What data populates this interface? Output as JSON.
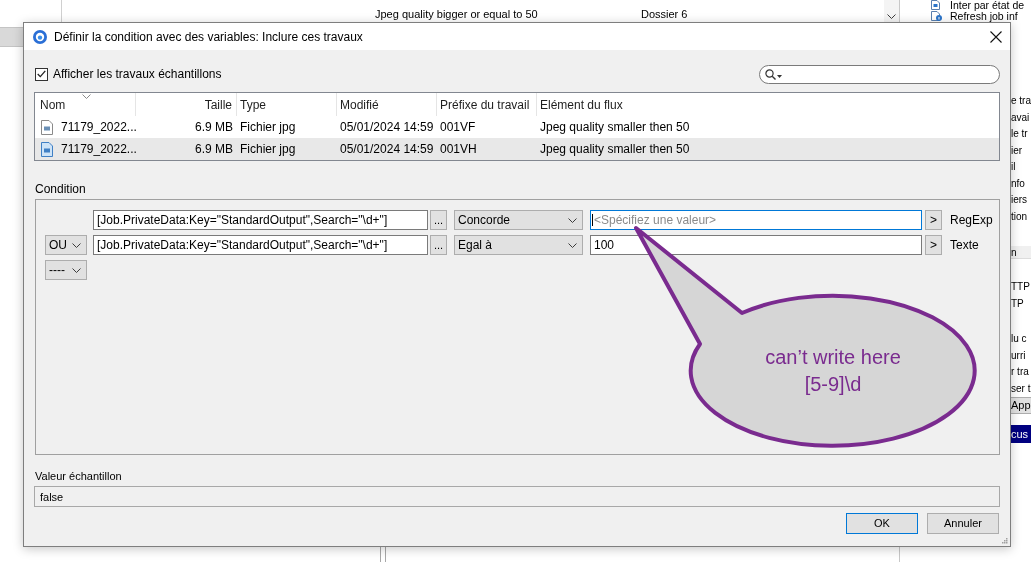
{
  "background": {
    "list_row": {
      "column_1": "Jpeg quality bigger or equal to 50",
      "column_2": "Dossier 6"
    },
    "side_panel": {
      "items": [
        {
          "label": "Inter par état de"
        },
        {
          "label": "Refresh job inf"
        }
      ],
      "groups": [
        {
          "items": [
            {
              "kind": "text",
              "text": "e tra"
            },
            {
              "kind": "text",
              "text": "avai"
            },
            {
              "kind": "text",
              "text": "le tr"
            },
            {
              "kind": "text",
              "text": "ier"
            },
            {
              "kind": "text",
              "text": "il"
            },
            {
              "kind": "text",
              "text": "nfo"
            },
            {
              "kind": "text",
              "text": "iers"
            },
            {
              "kind": "text",
              "text": "tion"
            }
          ]
        },
        {
          "items": [
            {
              "kind": "header",
              "text": "n"
            }
          ]
        },
        {
          "items": [
            {
              "kind": "text",
              "text": "TTP"
            },
            {
              "kind": "text",
              "text": "TP"
            }
          ]
        },
        {
          "items": [
            {
              "kind": "text",
              "text": "lu c"
            },
            {
              "kind": "text",
              "text": "urri"
            },
            {
              "kind": "text",
              "text": "r tra"
            },
            {
              "kind": "text",
              "text": "ser t"
            },
            {
              "kind": "button",
              "text": "App"
            }
          ]
        },
        {
          "items": [
            {
              "kind": "highlight",
              "text": "cus"
            }
          ]
        }
      ]
    }
  },
  "dialog": {
    "title": "Définir la condition avec des variables: Inclure ces travaux",
    "show_samples": {
      "label": "Afficher les travaux échantillons",
      "checked": true
    },
    "file_table": {
      "columns": [
        {
          "label": "Nom",
          "sorted": true
        },
        {
          "label": "Taille",
          "sorted": false
        },
        {
          "label": "Type",
          "sorted": false
        },
        {
          "label": "Modifié",
          "sorted": false
        },
        {
          "label": "Préfixe du travail",
          "sorted": false
        },
        {
          "label": "Elément du flux",
          "sorted": false
        }
      ],
      "rows": [
        {
          "selected": false,
          "cells": [
            "71179_2022...",
            "6.9 MB",
            "Fichier jpg",
            "05/01/2024 14:59",
            "001VF",
            "Jpeg quality smaller then 50"
          ]
        },
        {
          "selected": true,
          "cells": [
            "71179_2022...",
            "6.9 MB",
            "Fichier jpg",
            "05/01/2024 14:59",
            "001VH",
            "Jpeg quality smaller then 50"
          ]
        }
      ]
    },
    "condition": {
      "label": "Condition",
      "rows": [
        {
          "kind": "condition",
          "variable": "[Job.PrivateData:Key=\"StandardOutput\",Search=\"\\d+\"]",
          "browse": "...",
          "operator": "Concorde",
          "value_placeholder": "<Spécifiez une valeur>",
          "focused": true,
          "insert": ">",
          "value_type": "RegExp"
        },
        {
          "kind": "condition",
          "connector": "OU",
          "variable": "[Job.PrivateData:Key=\"StandardOutput\",Search=\"\\d+\"]",
          "browse": "...",
          "operator": "Egal à",
          "value": "100",
          "focused": false,
          "insert": ">",
          "value_type": "Texte"
        },
        {
          "kind": "connector",
          "connector": "----"
        }
      ]
    },
    "sample_value": {
      "label": "Valeur échantillon",
      "value": "false"
    },
    "buttons": [
      {
        "label": "OK",
        "default": true
      },
      {
        "label": "Annuler",
        "default": false
      }
    ]
  },
  "annotation": {
    "text": "can’t write here\n[5-9]\\d"
  }
}
